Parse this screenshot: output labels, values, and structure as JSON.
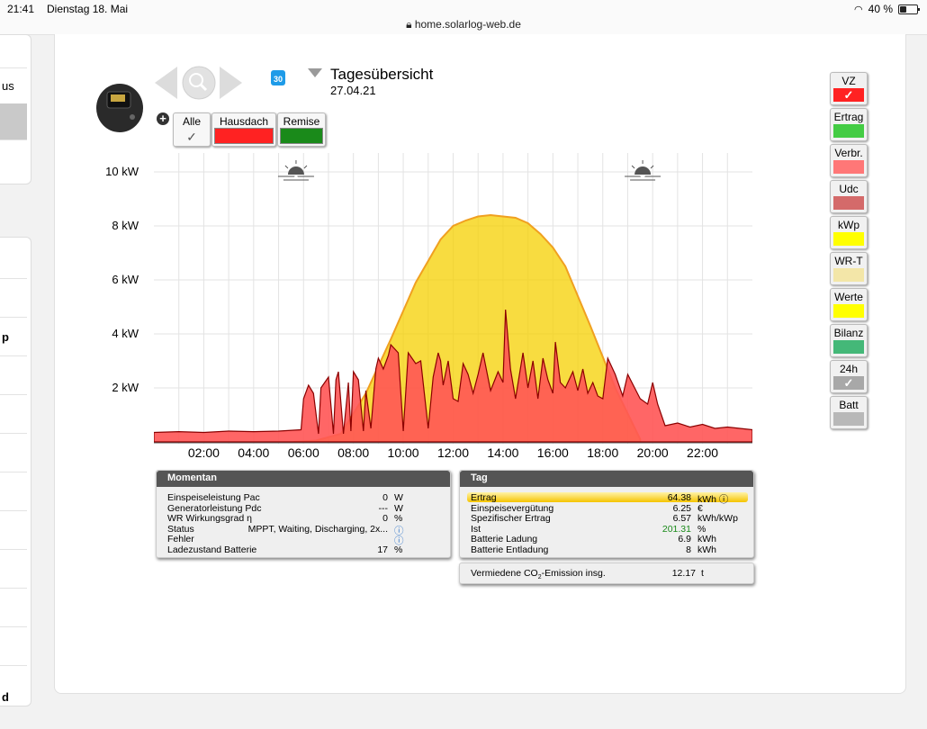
{
  "status_bar": {
    "time": "21:41",
    "date": "Dienstag 18. Mai",
    "url": "home.solarlog-web.de",
    "battery": "40 %",
    "battery_fraction": 0.4
  },
  "sidebar": {
    "item_partial_1": "us",
    "item_partial_2": "p",
    "item_partial_3": "d"
  },
  "header": {
    "title": "Tagesübersicht",
    "date": "27.04.21"
  },
  "filters": [
    {
      "label": "Alle",
      "color": "#ffffff",
      "checked": true
    },
    {
      "label": "Hausdach",
      "color": "#ff2222",
      "checked": false
    },
    {
      "label": "Remise",
      "color": "#1a8a1a",
      "checked": false
    }
  ],
  "chart_data": {
    "type": "area",
    "title": "",
    "y_tick_labels": [
      "10 kW",
      "8 kW",
      "6 kW",
      "4 kW",
      "2 kW"
    ],
    "y_ticks": [
      10,
      8,
      6,
      4,
      2
    ],
    "ylim": [
      0,
      10.7
    ],
    "xlim": [
      0,
      24
    ],
    "x_tick_labels": [
      "02:00",
      "04:00",
      "06:00",
      "08:00",
      "10:00",
      "12:00",
      "14:00",
      "16:00",
      "18:00",
      "20:00",
      "22:00"
    ],
    "x_ticks": [
      2,
      4,
      6,
      8,
      10,
      12,
      14,
      16,
      18,
      20,
      22
    ],
    "grid": true,
    "sunrise_hour": 5.7,
    "sunset_hour": 19.6,
    "series": [
      {
        "color": "#f5d000",
        "edge": "#f0a020",
        "x": [
          5.6,
          6.5,
          7.5,
          8.5,
          9.5,
          10.5,
          11.5,
          12.0,
          12.5,
          13.0,
          13.5,
          14.0,
          14.5,
          15.0,
          15.5,
          16.0,
          16.5,
          17.5,
          18.5,
          19.5
        ],
        "values": [
          0,
          0.05,
          0.3,
          1.8,
          3.8,
          5.9,
          7.5,
          8.0,
          8.2,
          8.35,
          8.4,
          8.35,
          8.3,
          8.1,
          7.7,
          7.2,
          6.5,
          4.3,
          2.0,
          0.1
        ]
      },
      {
        "color": "#ff5555",
        "edge": "#8b0000",
        "x": [
          0,
          1,
          2,
          3,
          4,
          5,
          5.9,
          6.0,
          6.2,
          6.4,
          6.6,
          6.7,
          7.0,
          7.2,
          7.3,
          7.4,
          7.6,
          7.8,
          7.9,
          8.0,
          8.2,
          8.4,
          8.5,
          8.7,
          8.9,
          9.0,
          9.2,
          9.4,
          9.5,
          9.8,
          10.0,
          10.2,
          10.5,
          10.7,
          11.0,
          11.2,
          11.4,
          11.5,
          11.6,
          11.8,
          12.0,
          12.2,
          12.4,
          12.6,
          12.8,
          13.0,
          13.2,
          13.5,
          13.8,
          14.0,
          14.1,
          14.3,
          14.5,
          14.8,
          15.0,
          15.2,
          15.4,
          15.6,
          15.8,
          16.0,
          16.1,
          16.3,
          16.5,
          16.8,
          17.0,
          17.2,
          17.4,
          17.6,
          17.8,
          18.0,
          18.2,
          18.5,
          18.8,
          19.0,
          19.5,
          19.8,
          20.0,
          20.2,
          20.5,
          21.0,
          21.5,
          22.0,
          22.5,
          23.0,
          23.5,
          24.0
        ],
        "values": [
          0.35,
          0.38,
          0.35,
          0.4,
          0.38,
          0.4,
          0.45,
          1.6,
          2.1,
          1.8,
          0.3,
          2.0,
          2.4,
          0.3,
          2.3,
          2.6,
          0.3,
          2.2,
          0.4,
          2.6,
          2.3,
          0.4,
          1.9,
          0.5,
          2.7,
          3.1,
          2.7,
          3.2,
          3.6,
          3.3,
          0.4,
          3.3,
          2.9,
          3.0,
          0.5,
          2.4,
          3.3,
          3.0,
          2.1,
          3.0,
          1.6,
          1.5,
          2.9,
          2.5,
          1.8,
          2.5,
          3.3,
          1.9,
          2.6,
          2.2,
          4.9,
          2.7,
          1.6,
          3.3,
          2.0,
          3.0,
          1.6,
          3.1,
          2.3,
          1.8,
          3.7,
          2.2,
          2.0,
          2.6,
          1.9,
          2.7,
          1.8,
          2.2,
          1.7,
          1.6,
          3.1,
          2.5,
          1.7,
          2.5,
          1.6,
          1.4,
          2.2,
          1.4,
          0.6,
          0.7,
          0.55,
          0.65,
          0.5,
          0.55,
          0.5,
          0.45
        ]
      }
    ]
  },
  "momentan": {
    "title": "Momentan",
    "rows": [
      {
        "label": "Einspeiseleistung Pac",
        "value": "0",
        "unit": "W"
      },
      {
        "label": "Generatorleistung Pdc",
        "value": "---",
        "unit": "W"
      },
      {
        "label": "WR Wirkungsgrad η",
        "value": "0",
        "unit": "%"
      },
      {
        "label": "Status",
        "value": "MPPT, Waiting, Discharging, 2x...",
        "unit": "ⓘ"
      },
      {
        "label": "Fehler",
        "value": "",
        "unit": "ⓘ"
      },
      {
        "label": "Ladezustand Batterie",
        "value": "17",
        "unit": "%"
      }
    ]
  },
  "tag": {
    "title": "Tag",
    "rows": [
      {
        "label": "Ertrag",
        "value": "64.38",
        "unit": "kWh ⓘ"
      },
      {
        "label": "Einspeisevergütung",
        "value": "6.25",
        "unit": "€"
      },
      {
        "label": "Spezifischer Ertrag",
        "value": "6.57",
        "unit": "kWh/kWp"
      },
      {
        "label": "Ist",
        "value": "201.31",
        "unit": "%"
      },
      {
        "label": "Batterie Ladung",
        "value": "6.9",
        "unit": "kWh"
      },
      {
        "label": "Batterie Entladung",
        "value": "8",
        "unit": "kWh"
      }
    ],
    "co2_label_pre": "Vermiedene CO",
    "co2_sub": "2",
    "co2_label_post": "-Emission insg.",
    "co2_value": "12.17",
    "co2_unit": "t"
  },
  "toggles": [
    {
      "label": "VZ",
      "color": "#ff2222",
      "checked": true
    },
    {
      "label": "Ertrag",
      "color": "#44cc44",
      "checked": false
    },
    {
      "label": "Verbr.",
      "color": "#ff7777",
      "checked": false
    },
    {
      "label": "Udc",
      "color": "#d46a6a",
      "checked": false
    },
    {
      "label": "kWp",
      "color": "#ffff00",
      "checked": false
    },
    {
      "label": "WR-T",
      "color": "#f3e6a8",
      "checked": false
    },
    {
      "label": "Werte",
      "color": "#ffff00",
      "checked": false
    },
    {
      "label": "Bilanz",
      "color": "#44b878",
      "checked": false
    },
    {
      "label": "24h",
      "color": "#a8a8a8",
      "checked": true
    },
    {
      "label": "Batt",
      "color": "#b8b8b8",
      "checked": false
    }
  ]
}
